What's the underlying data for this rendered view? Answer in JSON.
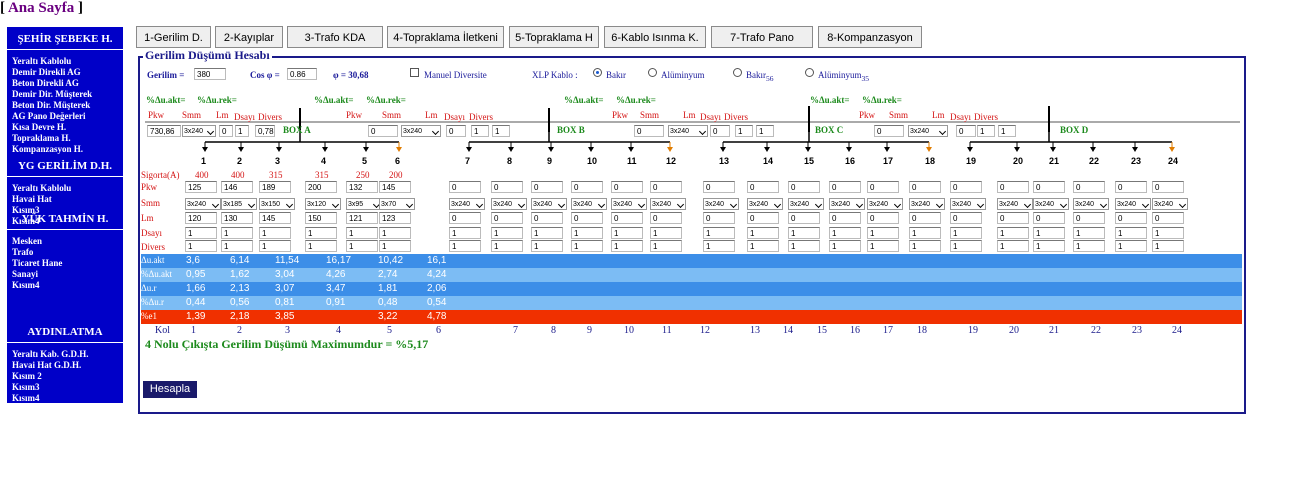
{
  "header": {
    "home_link": "Ana Sayfa",
    "bracket_open": "[",
    "bracket_close": "]"
  },
  "sidebar": {
    "sections": [
      {
        "title": "ŞEHİR ŞEBEKE H.",
        "items": [
          "Yeraltı Kablolu",
          "Demir Direkli AG",
          "Beton Direkli AG",
          "Demir Dir. Müşterek",
          "Beton Dir. Müşterek",
          "AG Pano Değerleri",
          "Kısa Devre H.",
          "Topraklama H.",
          "Kompanzasyon H."
        ]
      },
      {
        "title": "YG GERİLİM D.H.",
        "items": [
          "Yeraltı Kablolu",
          "Havai Hat",
          "Kısım3",
          "Kısım4"
        ]
      },
      {
        "title": "YÜK TAHMİN H.",
        "items": [
          "Mesken",
          "Trafo",
          "Ticaret Hane",
          "Sanayi",
          "Kısım4"
        ]
      },
      {
        "title": "AYDINLATMA",
        "items": [
          "Yeraltı Kab. G.D.H.",
          "Havai Hat G.D.H.",
          "Kısım 2",
          "Kısım3",
          "Kısım4"
        ]
      }
    ]
  },
  "tabs": [
    "1-Gerilim D.",
    "2-Kayıplar",
    "3-Trafo KDA",
    "4-Topraklama İletkeni",
    "5-Topraklama H",
    "6-Kablo Isınma K.",
    "7-Trafo Pano",
    "8-Kompanzasyon"
  ],
  "panel": {
    "title": "Gerilim Düşümü Hesabı",
    "gerilim_label": "Gerilim =",
    "gerilim_value": "380",
    "cos_label": "Cos φ =",
    "cos_value": "0.86",
    "phi_label": "φ = 30,68",
    "manuel_label": "Manuel Diversite",
    "xlp_label": "XLP Kablo :",
    "radios": [
      {
        "label": "Bakır",
        "sub": "",
        "checked": true
      },
      {
        "label": "Alüminyum",
        "sub": "",
        "checked": false
      },
      {
        "label": "Bakır",
        "sub": "56",
        "checked": false
      },
      {
        "label": "Alüminyum",
        "sub": "35",
        "checked": false
      }
    ],
    "pct_akt": "%Δu.akt=",
    "pct_rek": "%Δu.rek=",
    "box_labels": [
      "BOX A",
      "BOX B",
      "BOX C",
      "BOX D"
    ],
    "head_row_values": [
      "730,86",
      "3x240",
      "0",
      "1",
      "0,78"
    ],
    "box_inputs": [
      [
        "0",
        "3x240",
        "0",
        "1",
        "1"
      ],
      [
        "0",
        "3x240",
        "0",
        "1",
        "1"
      ],
      [
        "0",
        "3x240",
        "0",
        "1",
        "1"
      ]
    ],
    "col_numbers": [
      "1",
      "2",
      "3",
      "4",
      "5",
      "6",
      "7",
      "8",
      "9",
      "10",
      "11",
      "12",
      "13",
      "14",
      "15",
      "16",
      "17",
      "18",
      "19",
      "20",
      "21",
      "22",
      "23",
      "24"
    ],
    "row_labels": {
      "sigorta": "Sigorta(A)",
      "pkw": "Pkw",
      "smm": "Smm",
      "lm": "Lm",
      "dsayi": "Dsayı",
      "divers": "Divers"
    },
    "sigorta": [
      "400",
      "400",
      "315",
      "315",
      "250",
      "200"
    ],
    "pkw": [
      "125",
      "146",
      "189",
      "200",
      "132",
      "145",
      "0",
      "0",
      "0",
      "0",
      "0",
      "0",
      "0",
      "0",
      "0",
      "0",
      "0",
      "0",
      "0",
      "0",
      "0",
      "0",
      "0",
      "0"
    ],
    "smm": [
      "3x240",
      "3x185",
      "3x150",
      "3x120",
      "3x95",
      "3x70",
      "3x240",
      "3x240",
      "3x240",
      "3x240",
      "3x240",
      "3x240",
      "3x240",
      "3x240",
      "3x240",
      "3x240",
      "3x240",
      "3x240",
      "3x240",
      "3x240",
      "3x240",
      "3x240",
      "3x240",
      "3x240"
    ],
    "lm": [
      "120",
      "130",
      "145",
      "150",
      "121",
      "123",
      "0",
      "0",
      "0",
      "0",
      "0",
      "0",
      "0",
      "0",
      "0",
      "0",
      "0",
      "0",
      "0",
      "0",
      "0",
      "0",
      "0",
      "0"
    ],
    "dsayi": [
      "1",
      "1",
      "1",
      "1",
      "1",
      "1",
      "1",
      "1",
      "1",
      "1",
      "1",
      "1",
      "1",
      "1",
      "1",
      "1",
      "1",
      "1",
      "1",
      "1",
      "1",
      "1",
      "1",
      "1"
    ],
    "divers": [
      "1",
      "1",
      "1",
      "1",
      "1",
      "1",
      "1",
      "1",
      "1",
      "1",
      "1",
      "1",
      "1",
      "1",
      "1",
      "1",
      "1",
      "1",
      "1",
      "1",
      "1",
      "1",
      "1",
      "1"
    ],
    "results": [
      {
        "label": "Δu.akt",
        "color": "#3c8ee8",
        "values": [
          "3,6",
          "6,14",
          "11,54",
          "16,17",
          "10,42",
          "16,1"
        ]
      },
      {
        "label": "%Δu.akt",
        "color": "#7cbcf4",
        "values": [
          "0,95",
          "1,62",
          "3,04",
          "4,26",
          "2,74",
          "4,24"
        ]
      },
      {
        "label": "Δu.r",
        "color": "#3c8ee8",
        "values": [
          "1,66",
          "2,13",
          "3,07",
          "3,47",
          "1,81",
          "2,06"
        ]
      },
      {
        "label": "%Δu.r",
        "color": "#7cbcf4",
        "values": [
          "0,44",
          "0,56",
          "0,81",
          "0,91",
          "0,48",
          "0,54"
        ]
      },
      {
        "label": "%e1",
        "color": "#f03000",
        "values": [
          "1,39",
          "2,18",
          "3,85",
          "",
          "3,22",
          "4,78"
        ]
      }
    ],
    "kol_label": "Kol",
    "result_text": "4 Nolu Çıkışta Gerilim Düşümü Maximumdur = %5,17",
    "calc_button": "Hesapla"
  }
}
